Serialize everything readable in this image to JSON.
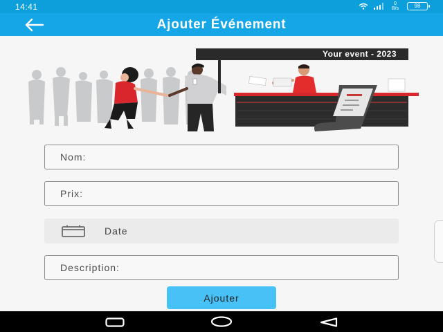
{
  "status_bar": {
    "time": "14:41",
    "net_speed_value": "0",
    "net_speed_unit": "B/s",
    "battery": "98",
    "icons": [
      "wifi-icon",
      "signal-icon",
      "battery-icon"
    ]
  },
  "app_bar": {
    "title": "Ajouter Événement",
    "back_icon": "arrow-left-icon"
  },
  "illustration": {
    "banner_text": "Your event - 2023"
  },
  "form": {
    "nom_placeholder": "Nom:",
    "prix_placeholder": "Prix:",
    "date_label": "Date",
    "date_icon": "calendar-icon",
    "description_placeholder": "Description:",
    "submit_label": "Ajouter"
  },
  "nav_bar": {
    "icons": [
      "square-icon",
      "circle-icon",
      "triangle-back-icon"
    ]
  },
  "colors": {
    "status_bar": "#0c9fdc",
    "app_bar": "#15a6e8",
    "button": "#48c1f7",
    "accent_red": "#e8282d",
    "booth_dark": "#2c2c2c"
  }
}
